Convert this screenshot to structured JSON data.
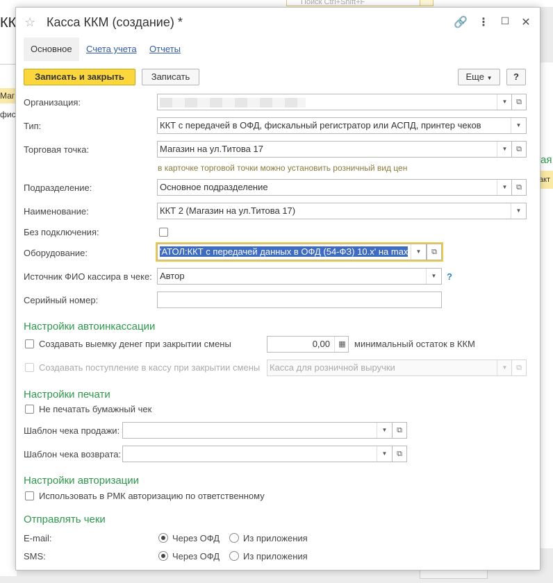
{
  "background": {
    "search_placeholder": "Поиск Ctrl+Shift+F",
    "page_title": "ККМ",
    "row1": "Маг",
    "row2": "фис",
    "right_green": "ая",
    "right_row": "акт"
  },
  "window": {
    "title": "Касса ККМ (создание) *",
    "tabs": [
      "Основное",
      "Счета учета",
      "Отчеты"
    ]
  },
  "toolbar": {
    "save_close": "Записать и закрыть",
    "save": "Записать",
    "more": "Еще",
    "help": "?"
  },
  "form": {
    "org_label": "Организация:",
    "org_value": "",
    "type_label": "Тип:",
    "type_value": "ККТ с передачей в ОФД, фискальный регистратор или АСПД, принтер чеков",
    "point_label": "Торговая точка:",
    "point_value": "Магазин на ул.Титова 17",
    "point_hint": "в карточке торговой точки можно установить розничный вид цен",
    "dept_label": "Подразделение:",
    "dept_value": "Основное подразделение",
    "name_label": "Наименование:",
    "name_value": "ККТ 2 (Магазин на ул.Титова 17)",
    "offline_label": "Без подключения:",
    "equip_label": "Оборудование:",
    "equip_value": "'АТОЛ:ККТ с передачей данных в ОФД (54-ФЗ) 10.x' на max",
    "cashier_label": "Источник ФИО кассира в чеке:",
    "cashier_value": "Автор",
    "cashier_help": "?",
    "serial_label": "Серийный номер:",
    "serial_value": ""
  },
  "collection": {
    "title": "Настройки автоинкассации",
    "withdraw_label": "Создавать выемку денег при закрытии смены",
    "withdraw_amount": "0,00",
    "min_rest_label": "минимальный остаток в ККМ",
    "receipt_label": "Создавать поступление в кассу при закрытии смены",
    "cashbox_value": "Касса для розничной выручки"
  },
  "print": {
    "title": "Настройки печати",
    "no_paper_label": "Не печатать бумажный чек",
    "sale_template_label": "Шаблон чека продажи:",
    "return_template_label": "Шаблон чека возврата:"
  },
  "auth": {
    "title": "Настройки авторизации",
    "rmk_label": "Использовать в РМК авторизацию по ответственному"
  },
  "send": {
    "title": "Отправлять чеки",
    "email_label": "E-mail:",
    "sms_label": "SMS:",
    "via_ofd": "Через ОФД",
    "from_app": "Из приложения"
  }
}
